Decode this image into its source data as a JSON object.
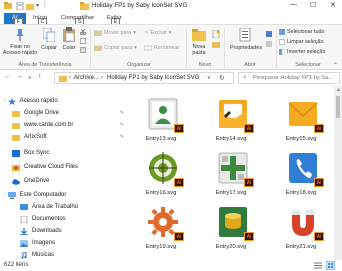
{
  "window": {
    "title": "Holiday FP1 by Saby IconSet SVG",
    "minimize": "—",
    "maximize": "☐",
    "close": "✕"
  },
  "ribbon_tabs": {
    "file": "Ar",
    "file_key": "F",
    "home": "Início",
    "home_key": "C",
    "share": "Compartilhar",
    "share_key": "S",
    "view": "Exibir",
    "view_key": "E"
  },
  "ribbon": {
    "pin": "Fixar no\nAcesso rápido",
    "copy": "Copiar",
    "paste": "Colar",
    "clipboard_group": "Área de Transferência",
    "move_to": "Mover para",
    "copy_to": "Copiar para",
    "delete": "Excluir",
    "rename": "Renomear",
    "organize_group": "Organizar",
    "new_folder": "Nova\npasta",
    "new_group": "Novo",
    "properties": "Propriedades",
    "open_group": "Abrir",
    "select_all": "Selecionar tudo",
    "clear_selection": "Limpar seleção",
    "invert_selection": "Inverter seleção",
    "select_group": "Selecionar"
  },
  "address": {
    "path_parts": [
      "Archive...",
      "Holiday FP1 by Saby IconSet SVG"
    ],
    "search_placeholder": "Pesquisar Holiday FP1 by Sa..."
  },
  "sidebar": {
    "items": [
      {
        "label": "Acesso rápido",
        "icon": "star-icon",
        "pinned": false
      },
      {
        "label": "Google Drive",
        "icon": "folder-icon",
        "pinned": true
      },
      {
        "label": "www.carde.com.br",
        "icon": "folder-icon",
        "pinned": true
      },
      {
        "label": "ArtixSoft",
        "icon": "folder-icon",
        "pinned": true
      },
      {
        "label": "Box Sync",
        "icon": "box-icon",
        "pinned": false
      },
      {
        "label": "Creative Cloud Files",
        "icon": "creative-cloud-icon",
        "pinned": false
      },
      {
        "label": "OneDrive",
        "icon": "onedrive-icon",
        "pinned": false
      },
      {
        "label": "Este Computador",
        "icon": "computer-icon",
        "pinned": false
      },
      {
        "label": "Área de Trabalho",
        "icon": "desktop-icon",
        "pinned": false
      },
      {
        "label": "Documentos",
        "icon": "documents-icon",
        "pinned": false
      },
      {
        "label": "Downloads",
        "icon": "downloads-icon",
        "pinned": false
      },
      {
        "label": "Imagens",
        "icon": "pictures-icon",
        "pinned": false
      },
      {
        "label": "Músicas",
        "icon": "music-icon",
        "pinned": false
      }
    ]
  },
  "files": [
    {
      "name": "Entry13.svg",
      "icon": "contact-card-icon"
    },
    {
      "name": "Entry14.svg",
      "icon": "open-envelope-icon"
    },
    {
      "name": "Entry15.svg",
      "icon": "envelope-icon"
    },
    {
      "name": "Entry16.svg",
      "icon": "target-icon"
    },
    {
      "name": "Entry17.svg",
      "icon": "calculator-icon"
    },
    {
      "name": "Entry18.svg",
      "icon": "phone-icon"
    },
    {
      "name": "Entry19.svg",
      "icon": "gear-icon"
    },
    {
      "name": "Entry20.svg",
      "icon": "coins-icon"
    },
    {
      "name": "Entry21.svg",
      "icon": "magnet-icon"
    }
  ],
  "status": {
    "count": "622 itens"
  }
}
